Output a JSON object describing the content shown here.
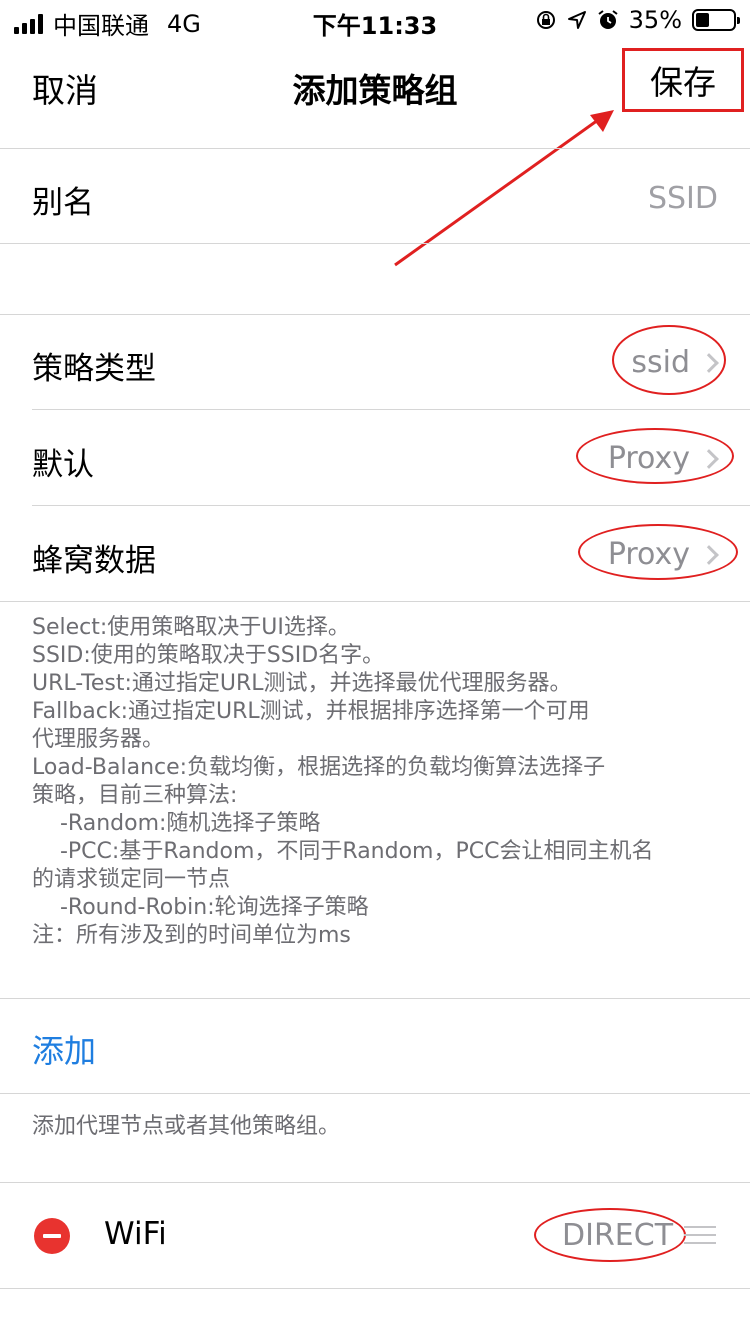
{
  "status_bar": {
    "carrier": "中国联通",
    "network": "4G",
    "time": "下午11:33",
    "battery": "35%",
    "battery_level": 0.35
  },
  "nav": {
    "cancel_label": "取消",
    "title": "添加策略组",
    "save_label": "保存"
  },
  "alias": {
    "label": "别名",
    "placeholder": "SSID"
  },
  "policy_rows": [
    {
      "label": "策略类型",
      "value": "ssid"
    },
    {
      "label": "默认",
      "value": "Proxy"
    },
    {
      "label": "蜂窝数据",
      "value": "Proxy"
    }
  ],
  "description_lines": [
    "Select:使用策略取决于UI选择。",
    "SSID:使用的策略取决于SSID名字。",
    "URL-Test:通过指定URL测试，并选择最优代理服务器。",
    "Fallback:通过指定URL测试，并根据排序选择第一个可用",
    "代理服务器。",
    "Load-Balance:负载均衡，根据选择的负载均衡算法选择子",
    "策略，目前三种算法:",
    "    -Random:随机选择子策略",
    "    -PCC:基于Random，不同于Random，PCC会让相同主机名",
    "的请求锁定同一节点",
    "    -Round-Robin:轮询选择子策略",
    "注：所有涉及到的时间单位为ms"
  ],
  "add": {
    "label": "添加",
    "hint": "添加代理节点或者其他策略组。"
  },
  "entries": [
    {
      "name": "WiFi",
      "policy": "DIRECT"
    }
  ],
  "colors": {
    "accent": "#1f7ee0",
    "annotation": "#e02020",
    "delete": "#e8332f"
  }
}
